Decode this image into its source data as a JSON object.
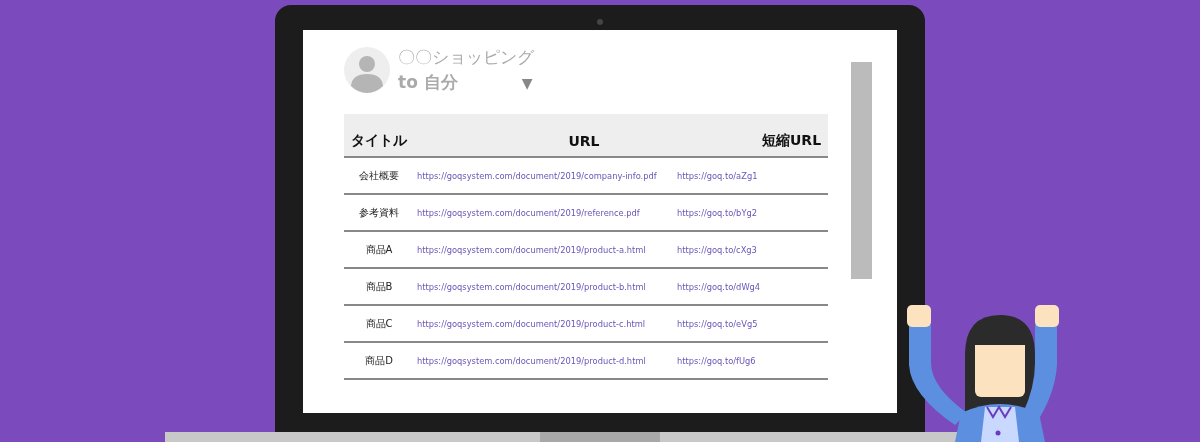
{
  "email": {
    "sender": "〇〇ショッピング",
    "recipient": "to 自分",
    "dropdown": "▼"
  },
  "table": {
    "columns": [
      "タイトル",
      "URL",
      "短縮URL"
    ],
    "rows": [
      {
        "title": "会社概要",
        "url": "https://goqsystem.com/document/2019/company-info.pdf",
        "short_url": "https://goq.to/aZg1"
      },
      {
        "title": "参考資料",
        "url": "https://goqsystem.com/document/2019/reference.pdf",
        "short_url": "https://goq.to/bYg2"
      },
      {
        "title": "商品A",
        "url": "https://goqsystem.com/document/2019/product-a.html",
        "short_url": "https://goq.to/cXg3"
      },
      {
        "title": "商品B",
        "url": "https://goqsystem.com/document/2019/product-b.html",
        "short_url": "https://goq.to/dWg4"
      },
      {
        "title": "商品C",
        "url": "https://goqsystem.com/document/2019/product-c.html",
        "short_url": "https://goq.to/eVg5"
      },
      {
        "title": "商品D",
        "url": "https://goqsystem.com/document/2019/product-d.html",
        "short_url": "https://goq.to/fUg6"
      }
    ]
  }
}
